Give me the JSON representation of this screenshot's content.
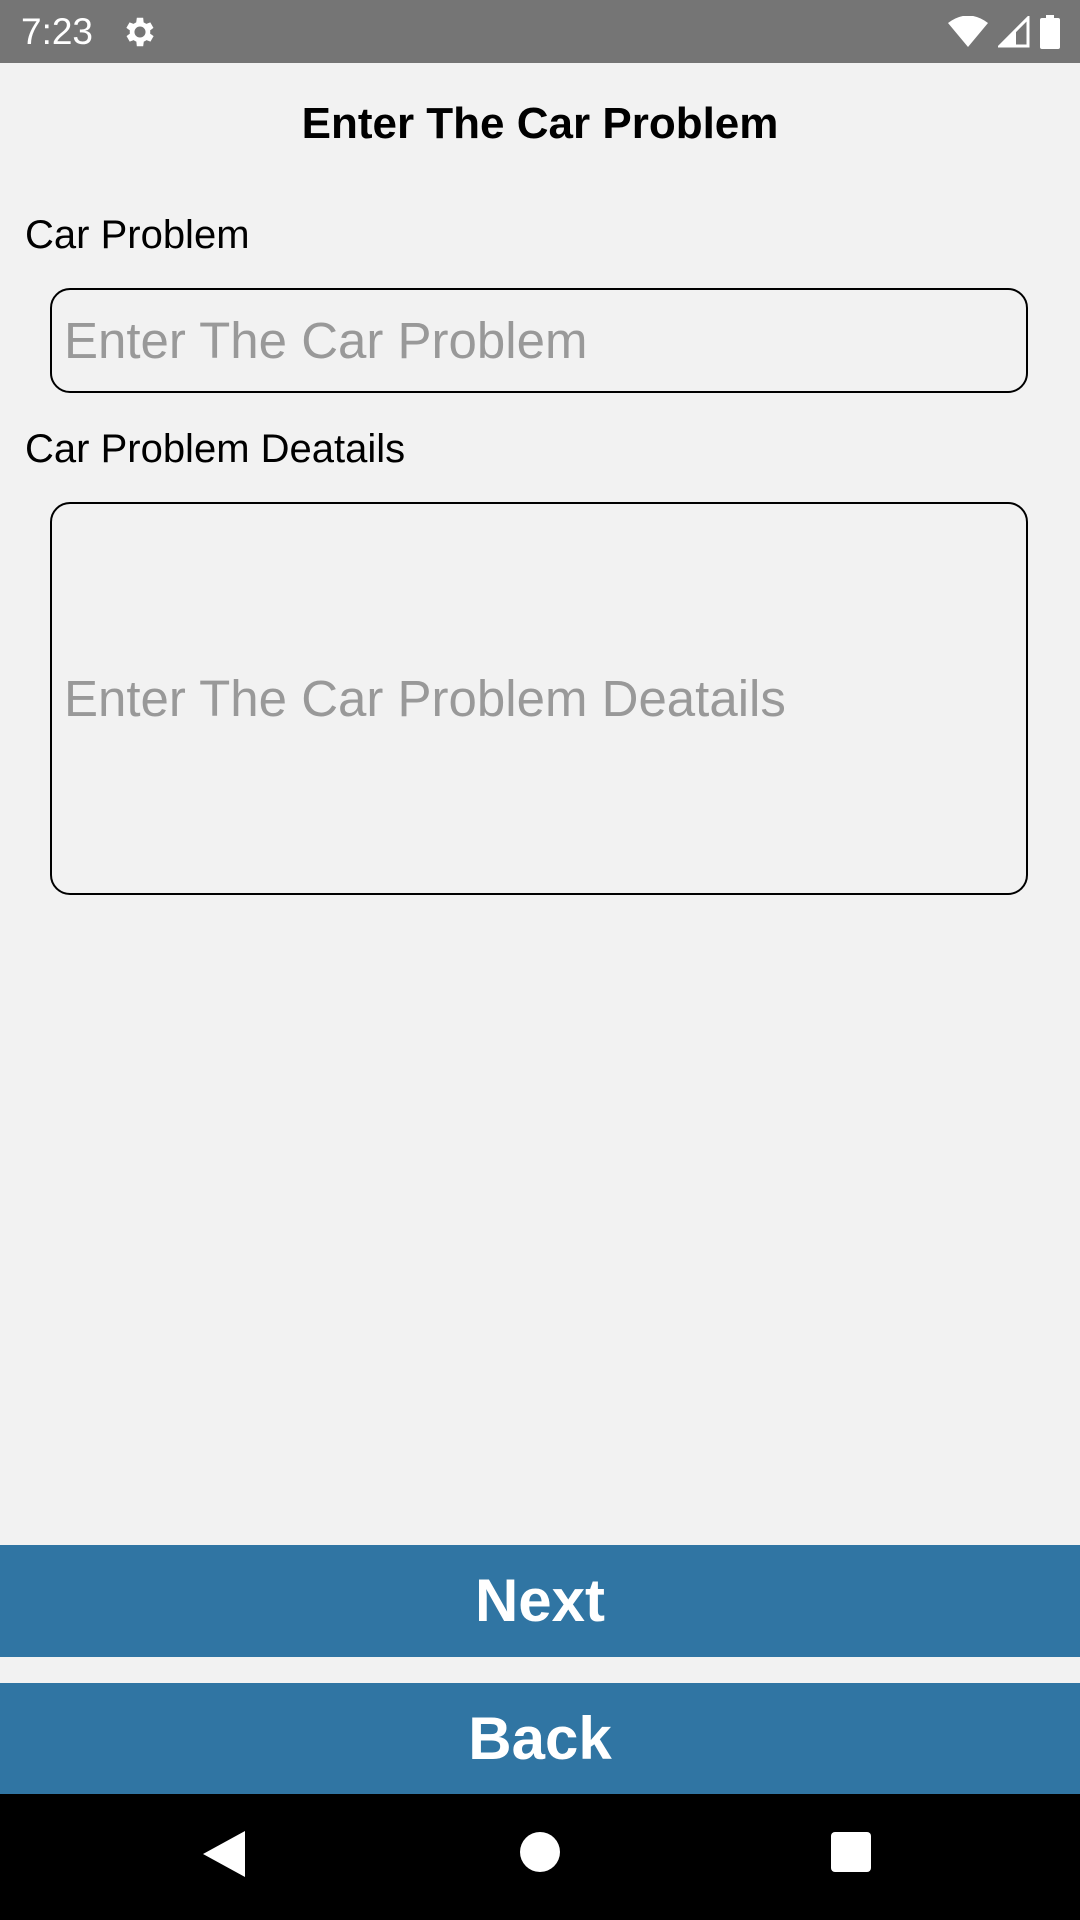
{
  "status_bar": {
    "time": "7:23",
    "icons": [
      "gear-icon",
      "wifi-icon",
      "signal-icon",
      "battery-icon"
    ],
    "background": "#757575"
  },
  "page": {
    "title": "Enter The Car Problem",
    "background": "#f2f2f2"
  },
  "form": {
    "problem_label": "Car Problem",
    "problem_value": "",
    "problem_placeholder": "Enter The Car Problem",
    "details_label": "Car Problem Deatails",
    "details_value": "",
    "details_placeholder": "Enter The Car Problem Deatails"
  },
  "buttons": {
    "next_label": "Next",
    "back_label": "Back",
    "color": "#3075a3"
  },
  "nav_bar": {
    "icons": [
      "back-triangle-icon",
      "home-circle-icon",
      "recents-square-icon"
    ]
  }
}
